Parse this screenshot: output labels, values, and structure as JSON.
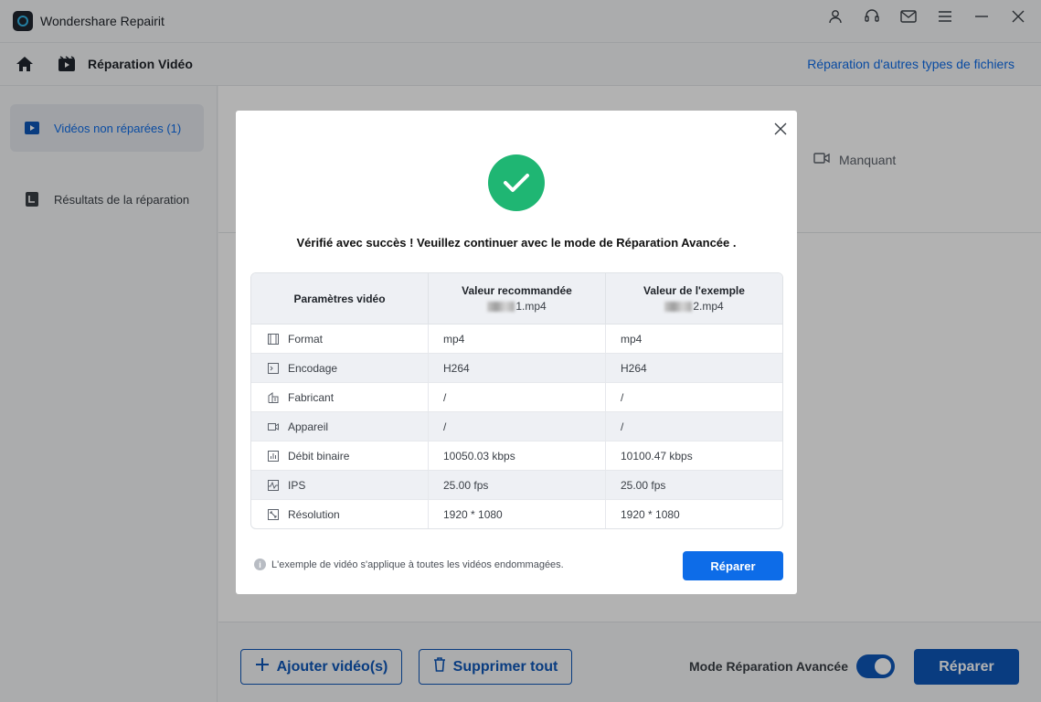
{
  "app": {
    "title": "Wondershare Repairit"
  },
  "nav": {
    "title": "Réparation Vidéo",
    "other_link": "Réparation d'autres types de fichiers"
  },
  "sidebar": {
    "items": [
      {
        "label": "Vidéos non réparées (1)",
        "icon": "play-box-icon",
        "active": true
      },
      {
        "label": "Résultats de la réparation",
        "icon": "document-corner-icon",
        "active": false
      }
    ]
  },
  "main": {
    "missing_label": "Manquant"
  },
  "bottom": {
    "add_label": "Ajouter vidéo(s)",
    "delete_label": "Supprimer tout",
    "mode_label": "Mode Réparation Avancée",
    "repair_label": "Réparer",
    "advanced_mode_enabled": true
  },
  "dialog": {
    "message": "Vérifié avec succès ! Veuillez continuer avec le mode de Réparation Avancée .",
    "table": {
      "headers": {
        "param": "Paramètres vidéo",
        "recommended": "Valeur recommandée",
        "recommended_file": "1.mp4",
        "sample": "Valeur de l'exemple",
        "sample_file": "2.mp4"
      },
      "rows": [
        {
          "param": "Format",
          "icon": "film-icon",
          "recommended": "mp4",
          "sample": "mp4"
        },
        {
          "param": "Encodage",
          "icon": "terminal-icon",
          "recommended": "H264",
          "sample": "H264"
        },
        {
          "param": "Fabricant",
          "icon": "building-icon",
          "recommended": "/",
          "sample": "/"
        },
        {
          "param": "Appareil",
          "icon": "camera-icon",
          "recommended": "/",
          "sample": "/"
        },
        {
          "param": "Débit binaire",
          "icon": "bar-chart-icon",
          "recommended": "10050.03 kbps",
          "sample": "10100.47 kbps"
        },
        {
          "param": "IPS",
          "icon": "pulse-icon",
          "recommended": "25.00 fps",
          "sample": "25.00 fps"
        },
        {
          "param": "Résolution",
          "icon": "resize-icon",
          "recommended": "1920 * 1080",
          "sample": "1920 * 1080"
        }
      ]
    },
    "note": "L'exemple de vidéo s'applique à toutes les vidéos endommagées.",
    "repair_label": "Réparer"
  },
  "colors": {
    "accent": "#0d6ce8",
    "dark_accent": "#0d56b8",
    "success": "#1fb673"
  }
}
